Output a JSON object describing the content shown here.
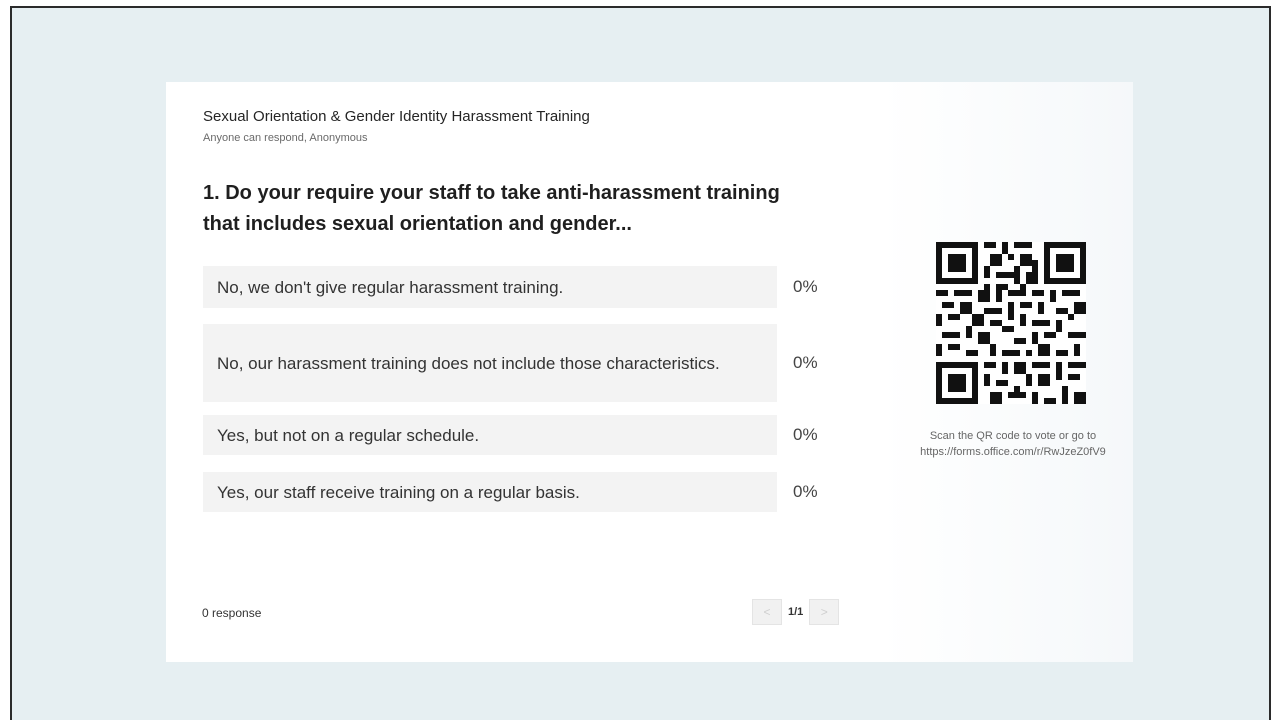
{
  "form": {
    "title": "Sexual Orientation & Gender Identity Harassment Training",
    "subtitle": "Anyone can respond, Anonymous",
    "question": "1. Do your require your staff to take anti-harassment training that includes sexual orientation and gender..."
  },
  "options": [
    {
      "label": "No, we don't give regular harassment training.",
      "percent": "0%"
    },
    {
      "label": "No, our harassment training does not include those characteristics.",
      "percent": "0%"
    },
    {
      "label": "Yes, but not on a regular schedule.",
      "percent": "0%"
    },
    {
      "label": "Yes, our staff receive training on a regular basis.",
      "percent": "0%"
    }
  ],
  "footer": {
    "response_count": "0 response",
    "prev_icon": "<",
    "next_icon": ">",
    "page": "1/1"
  },
  "qr": {
    "instruction": "Scan the QR code to vote or go to https://forms.office.com/r/RwJzeZ0fV9"
  },
  "colors": {
    "background": "#e6eff2",
    "card": "#ffffff",
    "option_bg": "#f3f3f3"
  }
}
